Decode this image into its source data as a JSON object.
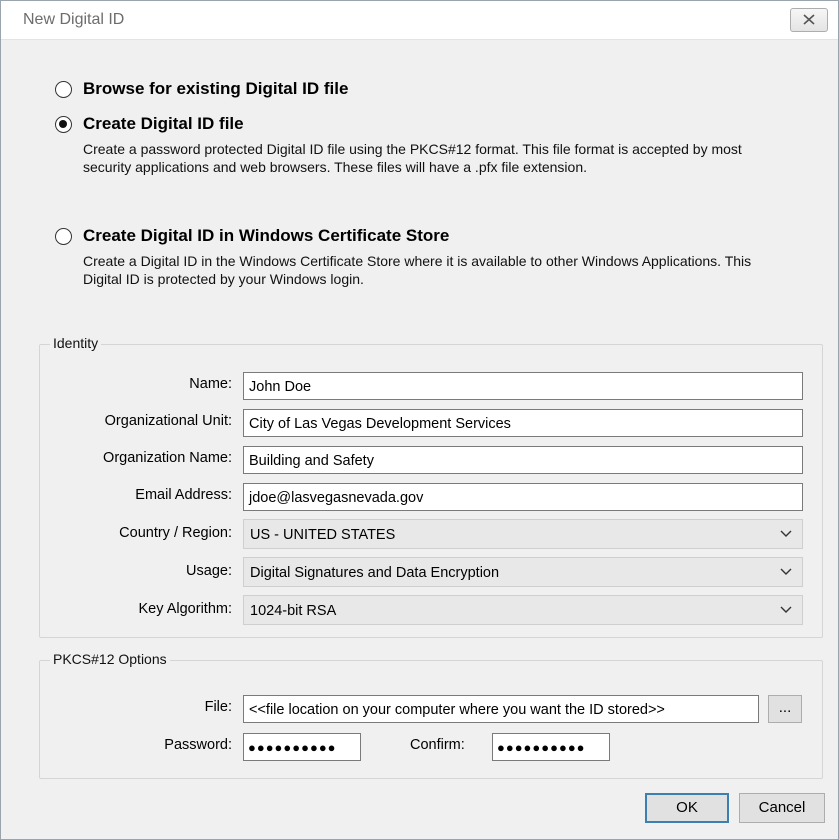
{
  "window": {
    "title": "New Digital ID"
  },
  "options": [
    {
      "label": "Browse for existing Digital ID file",
      "desc": "",
      "checked": false
    },
    {
      "label": "Create Digital ID file",
      "desc": "Create a password protected Digital ID file using the PKCS#12 format. This file format is accepted by most security applications and web browsers. These files will have a .pfx file extension.",
      "checked": true
    },
    {
      "label": "Create Digital ID in Windows Certificate Store",
      "desc": "Create a Digital ID in the Windows Certificate Store where it is available to other Windows Applications. This Digital ID is protected by your Windows login.",
      "checked": false
    }
  ],
  "identity": {
    "legend": "Identity",
    "name_label": "Name:",
    "name_value": "John Doe",
    "org_unit_label": "Organizational Unit:",
    "org_unit_value": "City of Las Vegas Development Services",
    "org_name_label": "Organization Name:",
    "org_name_value": "Building and Safety",
    "email_label": "Email Address:",
    "email_value": "jdoe@lasvegasnevada.gov",
    "country_label": "Country / Region:",
    "country_value": "US - UNITED STATES",
    "usage_label": "Usage:",
    "usage_value": "Digital Signatures and Data Encryption",
    "algo_label": "Key Algorithm:",
    "algo_value": "1024-bit RSA"
  },
  "pkcs": {
    "legend": "PKCS#12 Options",
    "file_label": "File:",
    "file_value": "<<file location on your computer where you want the ID stored>>",
    "browse_label": "...",
    "password_label": "Password:",
    "password_mask": "●●●●●●●●●●",
    "confirm_label": "Confirm:",
    "confirm_mask": "●●●●●●●●●●"
  },
  "buttons": {
    "ok": "OK",
    "cancel": "Cancel"
  }
}
